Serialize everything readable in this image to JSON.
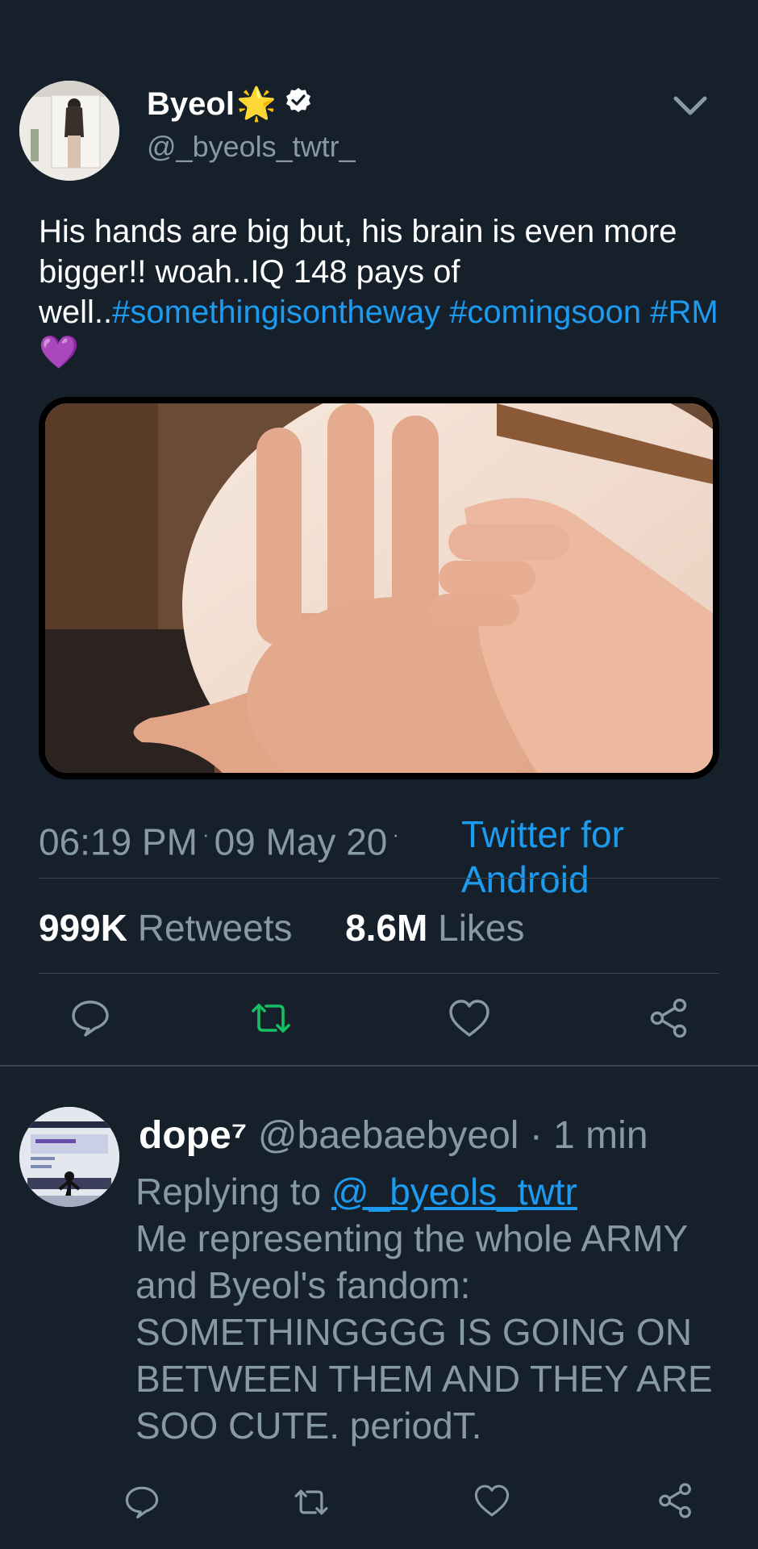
{
  "tweet": {
    "author_name": "Byeol",
    "author_emoji": "🌟",
    "handle": "@_byeols_twtr_",
    "text": "His hands are big but, his brain is even more bigger!! woah..IQ 148 pays of well..",
    "hashtags": [
      "#somethingisontheway",
      "#comingsoon",
      "#RM"
    ],
    "text_emoji": "💜",
    "time": "06:19 PM",
    "date": "09 May 20",
    "source": "Twitter for Android",
    "retweets_count": "999K",
    "retweets_label": "Retweets",
    "likes_count": "8.6M",
    "likes_label": "Likes"
  },
  "reply": {
    "author_name": "dope⁷",
    "handle": "@baebaebyeol",
    "separator": "·",
    "time": "1 min",
    "replying_label": "Replying to",
    "replying_to": "@_byeols_twtr",
    "text": "Me representing the whole ARMY and Byeol's fandom: SOMETHINGGGG IS GOING ON BETWEEN THEM AND THEY ARE SOO CUTE. periodT."
  },
  "icons": {
    "verified": "verified-badge-icon",
    "menu": "chevron-down-icon",
    "reply": "reply-icon",
    "retweet": "retweet-icon",
    "like": "heart-icon",
    "share": "share-icon"
  },
  "colors": {
    "background": "#15202b",
    "link": "#1d9bf0",
    "muted": "#8899a6",
    "retweet_active": "#17bf63"
  }
}
